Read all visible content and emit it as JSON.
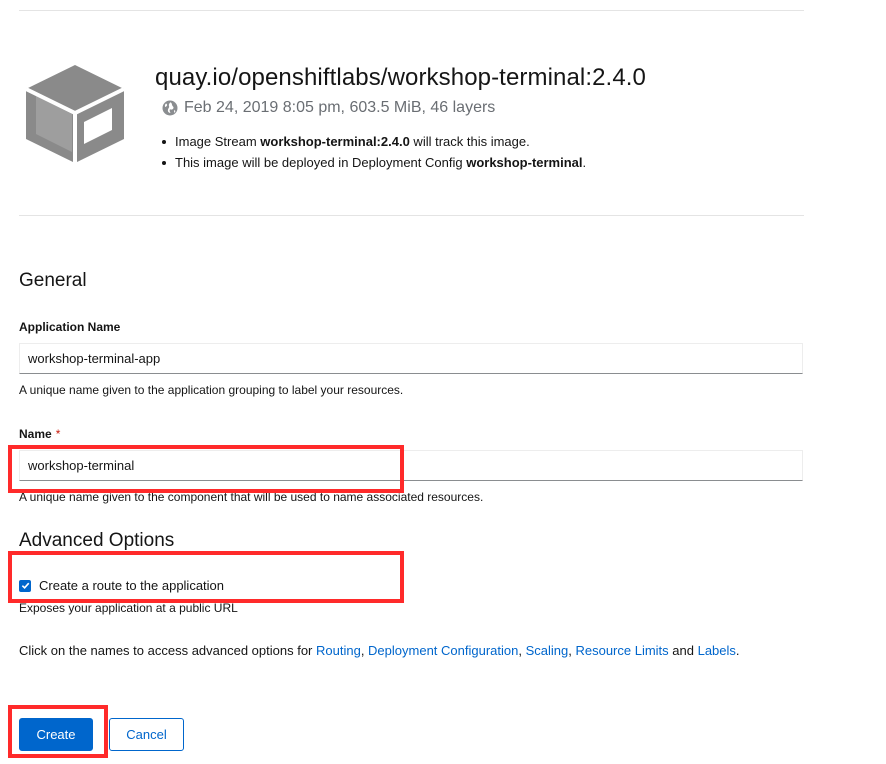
{
  "image": {
    "title": "quay.io/openshiftlabs/workshop-terminal:2.4.0",
    "meta": "Feb 24, 2019 8:05 pm, 603.5 MiB, 46 layers",
    "icon": "box-icon",
    "meta_icon": "globe-icon",
    "notes": [
      {
        "pre": "Image Stream ",
        "bold": "workshop-terminal:2.4.0",
        "post": " will track this image."
      },
      {
        "pre": "This image will be deployed in Deployment Config ",
        "bold": "workshop-terminal",
        "post": "."
      }
    ]
  },
  "general": {
    "title": "General",
    "app_name": {
      "label": "Application Name",
      "value": "workshop-terminal-app",
      "helper": "A unique name given to the application grouping to label your resources."
    },
    "name": {
      "label": "Name",
      "required_mark": "*",
      "value": "workshop-terminal",
      "helper": "A unique name given to the component that will be used to name associated resources."
    }
  },
  "advanced": {
    "title": "Advanced Options",
    "route_label": "Create a route to the application",
    "route_checked": true,
    "route_helper": "Exposes your application at a public URL",
    "links_intro": "Click on the names to access advanced options for ",
    "links": [
      "Routing",
      "Deployment Configuration",
      "Scaling",
      "Resource Limits",
      "Labels"
    ],
    "sep_comma": ", ",
    "sep_and": " and ",
    "links_end": "."
  },
  "actions": {
    "create": "Create",
    "cancel": "Cancel"
  },
  "colors": {
    "primary": "#0066cc",
    "highlight": "#ff2a2a",
    "icon_gray": "#8a8a8a"
  }
}
